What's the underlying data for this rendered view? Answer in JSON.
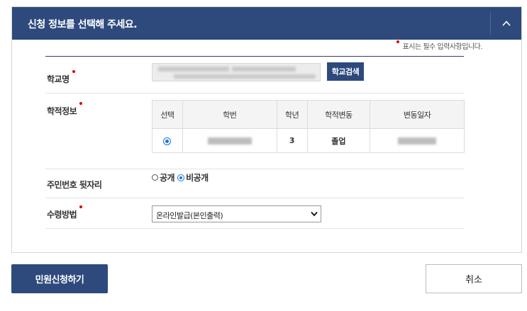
{
  "header": {
    "title": "신청 정보를 선택해 주세요.",
    "collapse_icon": "chevron-up-icon"
  },
  "required_note": "표시는 필수 입력사항입니다.",
  "colors": {
    "header_bg": "#2e4a7d",
    "required_mark": "#e00000",
    "radio_accent": "#1a73e8"
  },
  "school": {
    "label": "학교명",
    "value": "",
    "button": "학교검색"
  },
  "record": {
    "label": "학적정보",
    "columns": [
      "선택",
      "학번",
      "학년",
      "학적변동",
      "변동일자"
    ],
    "rows": [
      {
        "selected": true,
        "student_id": "",
        "grade": "3",
        "status": "졸업",
        "date": ""
      }
    ]
  },
  "resident_number": {
    "label": "주민번호 뒷자리",
    "options": [
      "공개",
      "비공개"
    ],
    "selected": "비공개"
  },
  "receive_method": {
    "label": "수령방법",
    "selected": "온라인발급(본인출력)"
  },
  "actions": {
    "submit": "민원신청하기",
    "cancel": "취소"
  }
}
